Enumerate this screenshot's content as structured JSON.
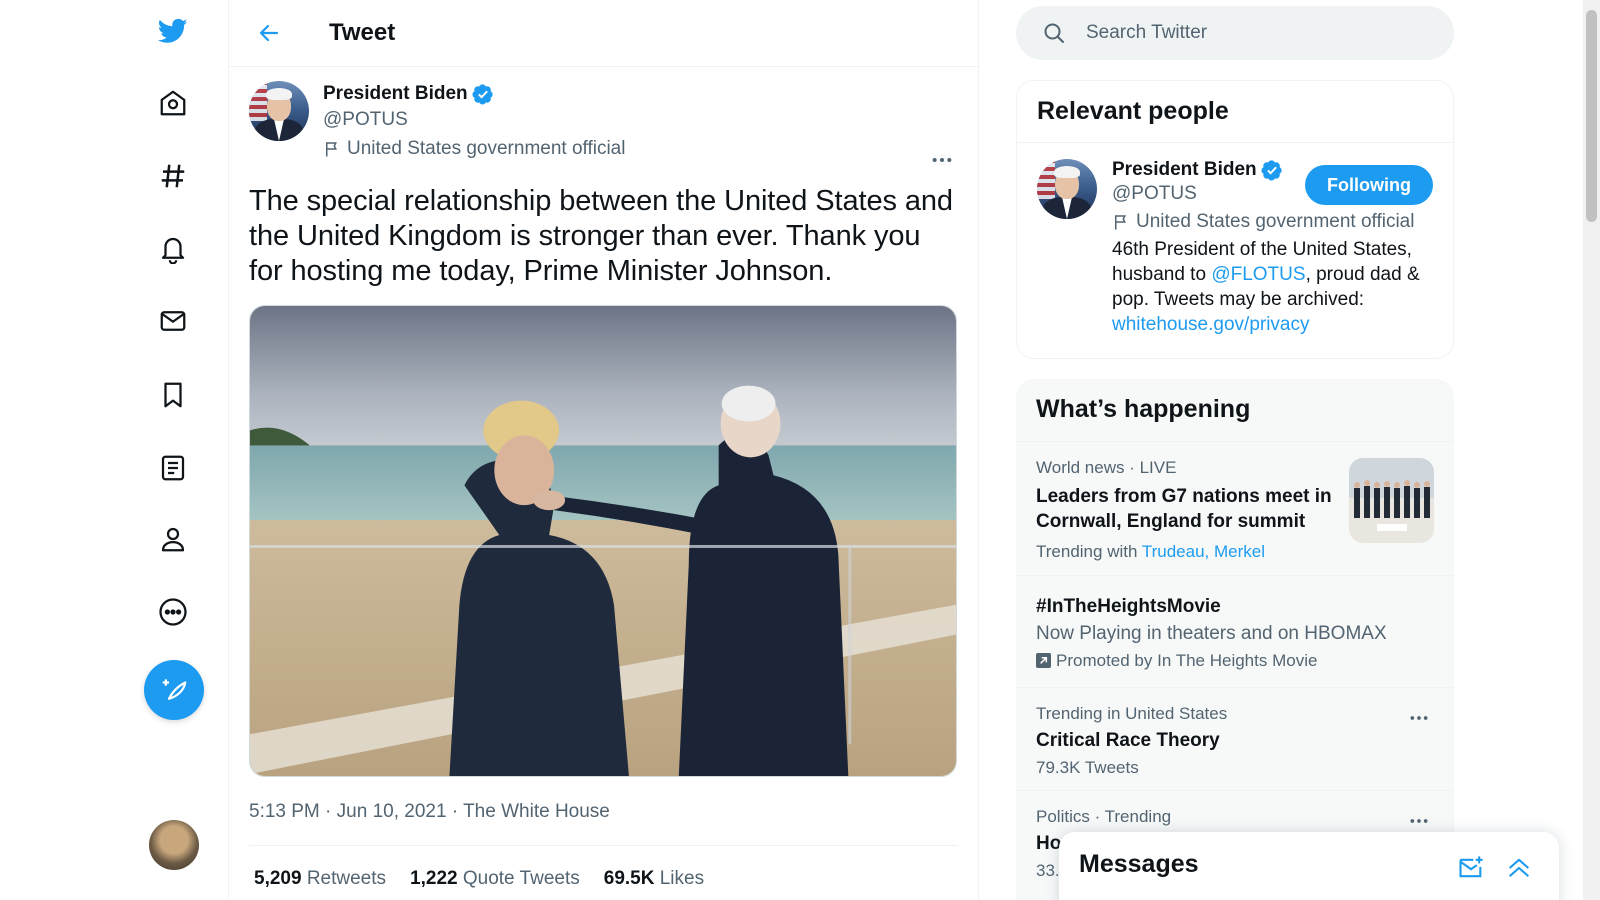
{
  "topbar": {
    "title": "Tweet"
  },
  "tweet": {
    "author_name": "President Biden",
    "author_handle": "@POTUS",
    "author_label": "United States government official",
    "text": "The special relationship between the United States and the United Kingdom is stronger than ever. Thank you for hosting me today, Prime Minister Johnson.",
    "time": "5:13 PM",
    "date": "Jun 10, 2021",
    "source": "The White House",
    "stats": [
      {
        "count": "5,209",
        "label": "Retweets"
      },
      {
        "count": "1,222",
        "label": "Quote Tweets"
      },
      {
        "count": "69.5K",
        "label": "Likes"
      }
    ]
  },
  "search": {
    "placeholder": "Search Twitter"
  },
  "relevant_people": {
    "title": "Relevant people",
    "name": "President Biden",
    "handle": "@POTUS",
    "label": "United States government official",
    "follow_label": "Following",
    "bio_part1": "46th President of the United States, husband to ",
    "bio_mention": "@FLOTUS",
    "bio_part2": ", proud dad & pop. Tweets may be archived: ",
    "bio_link": "whitehouse.gov/privacy"
  },
  "happening": {
    "title": "What’s happening",
    "trends": [
      {
        "context": "World news · LIVE",
        "title": "Leaders from G7 nations meet in Cornwall, England for summit",
        "trending_with_label": "Trending with",
        "trending_with_1": "Trudeau",
        "trending_with_sep": ",",
        "trending_with_2": "Merkel"
      },
      {
        "title": "#InTheHeightsMovie",
        "description": "Now Playing in theaters and on HBOMAX",
        "promoted": "Promoted by In The Heights Movie"
      },
      {
        "context": "Trending in United States",
        "title": "Critical Race Theory",
        "count": "79.3K Tweets"
      },
      {
        "context": "Politics · Trending",
        "title_visible": "Ho",
        "count_visible": "33."
      }
    ]
  },
  "messages": {
    "title": "Messages"
  },
  "colors": {
    "accent": "#1d9bf0",
    "text": "#0f1419",
    "muted": "#536471",
    "border": "#eff3f4"
  },
  "icons": [
    "twitter-logo-icon",
    "home-icon",
    "explore-icon",
    "notifications-icon",
    "messages-icon",
    "bookmarks-icon",
    "lists-icon",
    "profile-icon",
    "more-icon",
    "compose-icon",
    "back-arrow-icon",
    "verified-icon",
    "flag-icon",
    "search-icon",
    "new-message-icon",
    "chevron-up-icon"
  ]
}
